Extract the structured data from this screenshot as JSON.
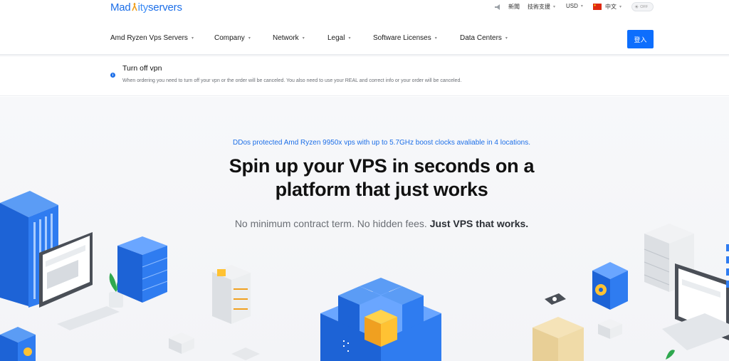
{
  "brand": {
    "logo_part1": "Mad",
    "logo_part2": "ity",
    "logo_part3": "servers"
  },
  "utility": {
    "news": "新聞",
    "support": "技術支援",
    "currency": "USD",
    "language": "中文",
    "toggle": "OFF"
  },
  "nav": {
    "items": [
      {
        "label": "Amd Ryzen Vps Servers"
      },
      {
        "label": "Company"
      },
      {
        "label": "Network"
      },
      {
        "label": "Legal"
      },
      {
        "label": "Software Licenses"
      },
      {
        "label": "Data Centers"
      }
    ],
    "login": "登入"
  },
  "notice": {
    "title": "Turn off vpn",
    "text": "When ordering you need to turn off your vpn or the order will be canceled. You also need to use your REAL and correct info or your order will be canceled."
  },
  "hero": {
    "tagline": "DDos protected Amd Ryzen 9950x vps with up to 5.7GHz boost clocks avaliable in 4 locations.",
    "headline_line1": "Spin up your VPS in seconds on a",
    "headline_line2": "platform that just works",
    "sub_prefix": "No minimum contract term. No hidden fees.",
    "sub_bold": "Just VPS that works."
  },
  "colors": {
    "accent": "#1d6fe8",
    "button": "#0d6efd"
  }
}
